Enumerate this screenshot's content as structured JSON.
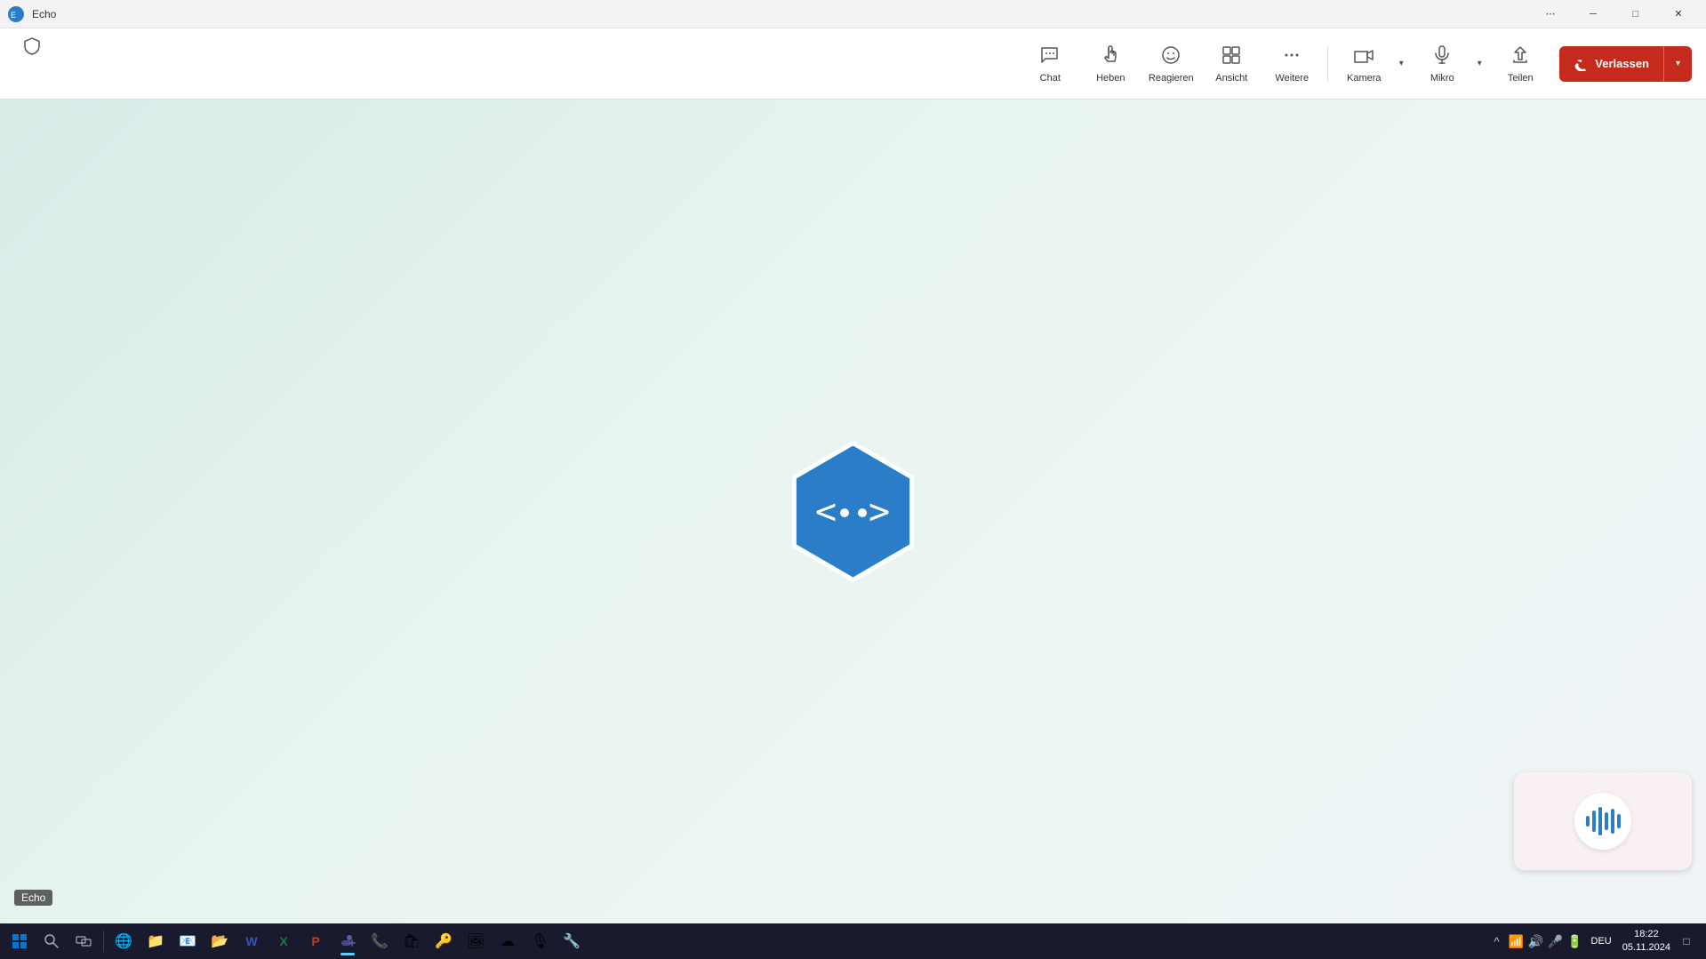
{
  "titlebar": {
    "title": "Echo",
    "controls": {
      "more": "⋯",
      "minimize": "─",
      "maximize": "□",
      "close": "✕"
    }
  },
  "toolbar": {
    "items": [
      {
        "id": "chat",
        "label": "Chat",
        "icon": "💬"
      },
      {
        "id": "heben",
        "label": "Heben",
        "icon": "✋"
      },
      {
        "id": "reagieren",
        "label": "Reagieren",
        "icon": "🙂"
      },
      {
        "id": "ansicht",
        "label": "Ansicht",
        "icon": "⊞"
      },
      {
        "id": "weitere",
        "label": "Weitere",
        "icon": "⋯"
      },
      {
        "id": "kamera",
        "label": "Kamera",
        "icon": "📷"
      },
      {
        "id": "mikro",
        "label": "Mikro",
        "icon": "🎤"
      },
      {
        "id": "teilen",
        "label": "Teilen",
        "icon": "⬆"
      }
    ],
    "verlassen": "Verlassen"
  },
  "main": {
    "logo_alt": "Azure DevOps Echo Logo"
  },
  "echo_label": "Echo",
  "audio_card": {
    "wave_color": "#2b7dc8"
  },
  "taskbar": {
    "clock": "18:22",
    "date": "05.11.2024",
    "lang": "DEU",
    "icons": [
      {
        "id": "start",
        "icon": "⊞",
        "color": "#0078d4"
      },
      {
        "id": "search",
        "icon": "🔍"
      },
      {
        "id": "taskview",
        "icon": "⧉"
      },
      {
        "id": "edge",
        "icon": "🌐"
      },
      {
        "id": "files",
        "icon": "📁"
      },
      {
        "id": "mail",
        "icon": "✉"
      },
      {
        "id": "calendar",
        "icon": "📅"
      },
      {
        "id": "word",
        "icon": "W"
      },
      {
        "id": "excel",
        "icon": "X"
      },
      {
        "id": "ppt",
        "icon": "P"
      },
      {
        "id": "teams",
        "icon": "T"
      },
      {
        "id": "phone",
        "icon": "📞"
      },
      {
        "id": "store",
        "icon": "🛍"
      },
      {
        "id": "keepass",
        "icon": "🔑"
      },
      {
        "id": "photos",
        "icon": "🖼"
      },
      {
        "id": "azure",
        "icon": "☁"
      },
      {
        "id": "recorder",
        "icon": "🎙"
      },
      {
        "id": "devtools",
        "icon": "🔧"
      }
    ],
    "tray": {
      "expand": "^",
      "wifi": "📶",
      "sound": "🔊",
      "mic": "🎤",
      "battery": "🔋"
    }
  }
}
